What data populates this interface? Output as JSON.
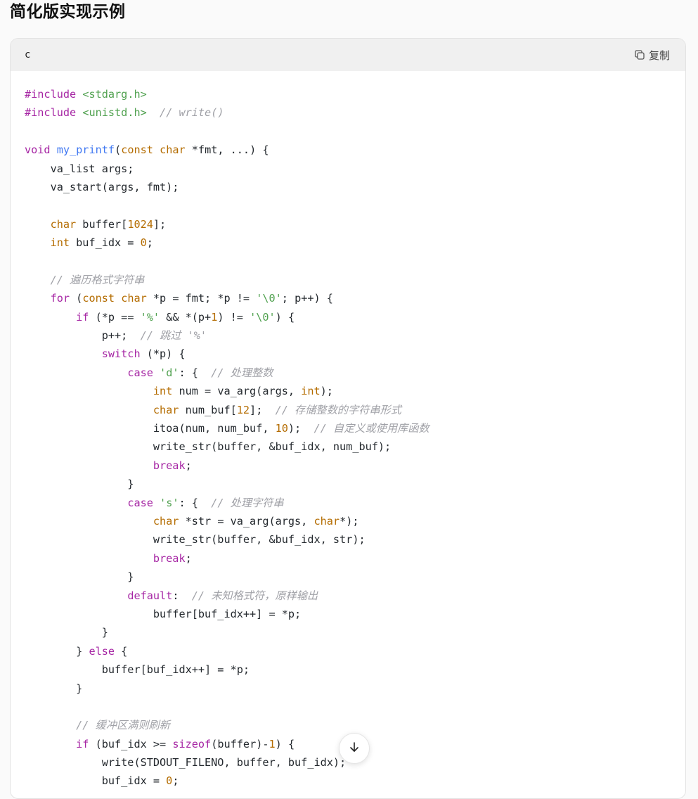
{
  "page": {
    "title": "简化版实现示例"
  },
  "code_block": {
    "language": "c",
    "copy_label": "复制",
    "lines": [
      [
        [
          "pre",
          "#include"
        ],
        [
          "txt",
          " "
        ],
        [
          "inc",
          "<stdarg.h>"
        ]
      ],
      [
        [
          "pre",
          "#include"
        ],
        [
          "txt",
          " "
        ],
        [
          "inc",
          "<unistd.h>"
        ],
        [
          "txt",
          "  "
        ],
        [
          "com",
          "// write()"
        ]
      ],
      [],
      [
        [
          "kw",
          "void"
        ],
        [
          "txt",
          " "
        ],
        [
          "fn",
          "my_printf"
        ],
        [
          "txt",
          "("
        ],
        [
          "type",
          "const"
        ],
        [
          "txt",
          " "
        ],
        [
          "type",
          "char"
        ],
        [
          "txt",
          " *fmt, ...) {"
        ]
      ],
      [
        [
          "txt",
          "    va_list args;"
        ]
      ],
      [
        [
          "txt",
          "    va_start(args, fmt);"
        ]
      ],
      [],
      [
        [
          "txt",
          "    "
        ],
        [
          "type",
          "char"
        ],
        [
          "txt",
          " buffer["
        ],
        [
          "num",
          "1024"
        ],
        [
          "txt",
          "];"
        ]
      ],
      [
        [
          "txt",
          "    "
        ],
        [
          "type",
          "int"
        ],
        [
          "txt",
          " buf_idx = "
        ],
        [
          "num",
          "0"
        ],
        [
          "txt",
          ";"
        ]
      ],
      [],
      [
        [
          "txt",
          "    "
        ],
        [
          "com",
          "// 遍历格式字符串"
        ]
      ],
      [
        [
          "txt",
          "    "
        ],
        [
          "kw",
          "for"
        ],
        [
          "txt",
          " ("
        ],
        [
          "type",
          "const"
        ],
        [
          "txt",
          " "
        ],
        [
          "type",
          "char"
        ],
        [
          "txt",
          " *p = fmt; *p != "
        ],
        [
          "str",
          "'\\0'"
        ],
        [
          "txt",
          "; p++) {"
        ]
      ],
      [
        [
          "txt",
          "        "
        ],
        [
          "kw",
          "if"
        ],
        [
          "txt",
          " (*p == "
        ],
        [
          "str",
          "'%'"
        ],
        [
          "txt",
          " && *(p+"
        ],
        [
          "num",
          "1"
        ],
        [
          "txt",
          ") != "
        ],
        [
          "str",
          "'\\0'"
        ],
        [
          "txt",
          ") {"
        ]
      ],
      [
        [
          "txt",
          "            p++;  "
        ],
        [
          "com",
          "// 跳过 '%'"
        ]
      ],
      [
        [
          "txt",
          "            "
        ],
        [
          "kw",
          "switch"
        ],
        [
          "txt",
          " (*p) {"
        ]
      ],
      [
        [
          "txt",
          "                "
        ],
        [
          "kw",
          "case"
        ],
        [
          "txt",
          " "
        ],
        [
          "str",
          "'d'"
        ],
        [
          "txt",
          ": {  "
        ],
        [
          "com",
          "// 处理整数"
        ]
      ],
      [
        [
          "txt",
          "                    "
        ],
        [
          "type",
          "int"
        ],
        [
          "txt",
          " num = va_arg(args, "
        ],
        [
          "type",
          "int"
        ],
        [
          "txt",
          ");"
        ]
      ],
      [
        [
          "txt",
          "                    "
        ],
        [
          "type",
          "char"
        ],
        [
          "txt",
          " num_buf["
        ],
        [
          "num",
          "12"
        ],
        [
          "txt",
          "];  "
        ],
        [
          "com",
          "// 存储整数的字符串形式"
        ]
      ],
      [
        [
          "txt",
          "                    itoa(num, num_buf, "
        ],
        [
          "num",
          "10"
        ],
        [
          "txt",
          ");  "
        ],
        [
          "com",
          "// 自定义或使用库函数"
        ]
      ],
      [
        [
          "txt",
          "                    write_str(buffer, &buf_idx, num_buf);"
        ]
      ],
      [
        [
          "txt",
          "                    "
        ],
        [
          "kw",
          "break"
        ],
        [
          "txt",
          ";"
        ]
      ],
      [
        [
          "txt",
          "                }"
        ]
      ],
      [
        [
          "txt",
          "                "
        ],
        [
          "kw",
          "case"
        ],
        [
          "txt",
          " "
        ],
        [
          "str",
          "'s'"
        ],
        [
          "txt",
          ": {  "
        ],
        [
          "com",
          "// 处理字符串"
        ]
      ],
      [
        [
          "txt",
          "                    "
        ],
        [
          "type",
          "char"
        ],
        [
          "txt",
          " *str = va_arg(args, "
        ],
        [
          "type",
          "char"
        ],
        [
          "txt",
          "*);"
        ]
      ],
      [
        [
          "txt",
          "                    write_str(buffer, &buf_idx, str);"
        ]
      ],
      [
        [
          "txt",
          "                    "
        ],
        [
          "kw",
          "break"
        ],
        [
          "txt",
          ";"
        ]
      ],
      [
        [
          "txt",
          "                }"
        ]
      ],
      [
        [
          "txt",
          "                "
        ],
        [
          "kw",
          "default"
        ],
        [
          "txt",
          ":  "
        ],
        [
          "com",
          "// 未知格式符，原样输出"
        ]
      ],
      [
        [
          "txt",
          "                    buffer[buf_idx++] = *p;"
        ]
      ],
      [
        [
          "txt",
          "            }"
        ]
      ],
      [
        [
          "txt",
          "        } "
        ],
        [
          "kw",
          "else"
        ],
        [
          "txt",
          " {"
        ]
      ],
      [
        [
          "txt",
          "            buffer[buf_idx++] = *p;"
        ]
      ],
      [
        [
          "txt",
          "        }"
        ]
      ],
      [],
      [
        [
          "txt",
          "        "
        ],
        [
          "com",
          "// 缓冲区满则刷新"
        ]
      ],
      [
        [
          "txt",
          "        "
        ],
        [
          "kw",
          "if"
        ],
        [
          "txt",
          " (buf_idx >= "
        ],
        [
          "kw",
          "sizeof"
        ],
        [
          "txt",
          "(buffer)-"
        ],
        [
          "num",
          "1"
        ],
        [
          "txt",
          ") {"
        ]
      ],
      [
        [
          "txt",
          "            write(STDOUT_FILENO, buffer, buf_idx);"
        ]
      ],
      [
        [
          "txt",
          "            buf_idx = "
        ],
        [
          "num",
          "0"
        ],
        [
          "txt",
          ";"
        ]
      ]
    ]
  },
  "icons": {
    "copy": "copy-icon",
    "scroll_down": "arrow-down-icon"
  }
}
